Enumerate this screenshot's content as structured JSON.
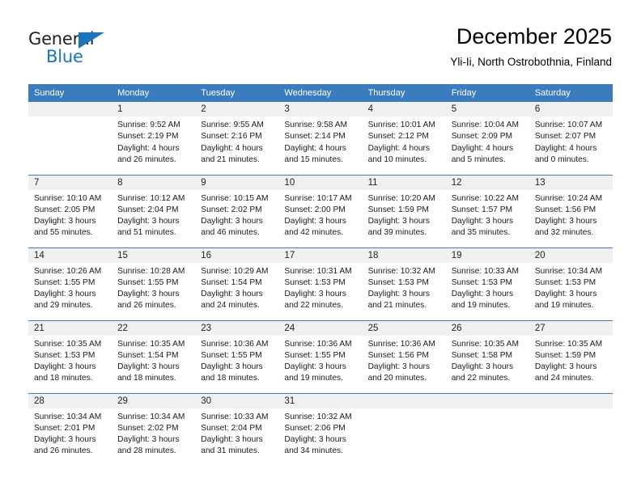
{
  "logo": {
    "word_top": "General",
    "word_bottom": "Blue",
    "triangle_icon": "triangle-icon",
    "color_dark": "#231f20",
    "color_blue": "#1b75bb"
  },
  "header": {
    "title": "December 2025",
    "subtitle": "Yli-Ii, North Ostrobothnia, Finland"
  },
  "theme": {
    "header_bg": "#3b7cbf",
    "header_text": "#ffffff",
    "daynum_bg": "#f0f0f0",
    "grid_line": "#3b7cbf"
  },
  "weekday_headers": [
    "Sunday",
    "Monday",
    "Tuesday",
    "Wednesday",
    "Thursday",
    "Friday",
    "Saturday"
  ],
  "weeks": [
    [
      {
        "day": "",
        "l1": "",
        "l2": "",
        "l3": "",
        "l4": ""
      },
      {
        "day": "1",
        "l1": "Sunrise: 9:52 AM",
        "l2": "Sunset: 2:19 PM",
        "l3": "Daylight: 4 hours",
        "l4": "and 26 minutes."
      },
      {
        "day": "2",
        "l1": "Sunrise: 9:55 AM",
        "l2": "Sunset: 2:16 PM",
        "l3": "Daylight: 4 hours",
        "l4": "and 21 minutes."
      },
      {
        "day": "3",
        "l1": "Sunrise: 9:58 AM",
        "l2": "Sunset: 2:14 PM",
        "l3": "Daylight: 4 hours",
        "l4": "and 15 minutes."
      },
      {
        "day": "4",
        "l1": "Sunrise: 10:01 AM",
        "l2": "Sunset: 2:12 PM",
        "l3": "Daylight: 4 hours",
        "l4": "and 10 minutes."
      },
      {
        "day": "5",
        "l1": "Sunrise: 10:04 AM",
        "l2": "Sunset: 2:09 PM",
        "l3": "Daylight: 4 hours",
        "l4": "and 5 minutes."
      },
      {
        "day": "6",
        "l1": "Sunrise: 10:07 AM",
        "l2": "Sunset: 2:07 PM",
        "l3": "Daylight: 4 hours",
        "l4": "and 0 minutes."
      }
    ],
    [
      {
        "day": "7",
        "l1": "Sunrise: 10:10 AM",
        "l2": "Sunset: 2:05 PM",
        "l3": "Daylight: 3 hours",
        "l4": "and 55 minutes."
      },
      {
        "day": "8",
        "l1": "Sunrise: 10:12 AM",
        "l2": "Sunset: 2:04 PM",
        "l3": "Daylight: 3 hours",
        "l4": "and 51 minutes."
      },
      {
        "day": "9",
        "l1": "Sunrise: 10:15 AM",
        "l2": "Sunset: 2:02 PM",
        "l3": "Daylight: 3 hours",
        "l4": "and 46 minutes."
      },
      {
        "day": "10",
        "l1": "Sunrise: 10:17 AM",
        "l2": "Sunset: 2:00 PM",
        "l3": "Daylight: 3 hours",
        "l4": "and 42 minutes."
      },
      {
        "day": "11",
        "l1": "Sunrise: 10:20 AM",
        "l2": "Sunset: 1:59 PM",
        "l3": "Daylight: 3 hours",
        "l4": "and 39 minutes."
      },
      {
        "day": "12",
        "l1": "Sunrise: 10:22 AM",
        "l2": "Sunset: 1:57 PM",
        "l3": "Daylight: 3 hours",
        "l4": "and 35 minutes."
      },
      {
        "day": "13",
        "l1": "Sunrise: 10:24 AM",
        "l2": "Sunset: 1:56 PM",
        "l3": "Daylight: 3 hours",
        "l4": "and 32 minutes."
      }
    ],
    [
      {
        "day": "14",
        "l1": "Sunrise: 10:26 AM",
        "l2": "Sunset: 1:55 PM",
        "l3": "Daylight: 3 hours",
        "l4": "and 29 minutes."
      },
      {
        "day": "15",
        "l1": "Sunrise: 10:28 AM",
        "l2": "Sunset: 1:55 PM",
        "l3": "Daylight: 3 hours",
        "l4": "and 26 minutes."
      },
      {
        "day": "16",
        "l1": "Sunrise: 10:29 AM",
        "l2": "Sunset: 1:54 PM",
        "l3": "Daylight: 3 hours",
        "l4": "and 24 minutes."
      },
      {
        "day": "17",
        "l1": "Sunrise: 10:31 AM",
        "l2": "Sunset: 1:53 PM",
        "l3": "Daylight: 3 hours",
        "l4": "and 22 minutes."
      },
      {
        "day": "18",
        "l1": "Sunrise: 10:32 AM",
        "l2": "Sunset: 1:53 PM",
        "l3": "Daylight: 3 hours",
        "l4": "and 21 minutes."
      },
      {
        "day": "19",
        "l1": "Sunrise: 10:33 AM",
        "l2": "Sunset: 1:53 PM",
        "l3": "Daylight: 3 hours",
        "l4": "and 19 minutes."
      },
      {
        "day": "20",
        "l1": "Sunrise: 10:34 AM",
        "l2": "Sunset: 1:53 PM",
        "l3": "Daylight: 3 hours",
        "l4": "and 19 minutes."
      }
    ],
    [
      {
        "day": "21",
        "l1": "Sunrise: 10:35 AM",
        "l2": "Sunset: 1:53 PM",
        "l3": "Daylight: 3 hours",
        "l4": "and 18 minutes."
      },
      {
        "day": "22",
        "l1": "Sunrise: 10:35 AM",
        "l2": "Sunset: 1:54 PM",
        "l3": "Daylight: 3 hours",
        "l4": "and 18 minutes."
      },
      {
        "day": "23",
        "l1": "Sunrise: 10:36 AM",
        "l2": "Sunset: 1:55 PM",
        "l3": "Daylight: 3 hours",
        "l4": "and 18 minutes."
      },
      {
        "day": "24",
        "l1": "Sunrise: 10:36 AM",
        "l2": "Sunset: 1:55 PM",
        "l3": "Daylight: 3 hours",
        "l4": "and 19 minutes."
      },
      {
        "day": "25",
        "l1": "Sunrise: 10:36 AM",
        "l2": "Sunset: 1:56 PM",
        "l3": "Daylight: 3 hours",
        "l4": "and 20 minutes."
      },
      {
        "day": "26",
        "l1": "Sunrise: 10:35 AM",
        "l2": "Sunset: 1:58 PM",
        "l3": "Daylight: 3 hours",
        "l4": "and 22 minutes."
      },
      {
        "day": "27",
        "l1": "Sunrise: 10:35 AM",
        "l2": "Sunset: 1:59 PM",
        "l3": "Daylight: 3 hours",
        "l4": "and 24 minutes."
      }
    ],
    [
      {
        "day": "28",
        "l1": "Sunrise: 10:34 AM",
        "l2": "Sunset: 2:01 PM",
        "l3": "Daylight: 3 hours",
        "l4": "and 26 minutes."
      },
      {
        "day": "29",
        "l1": "Sunrise: 10:34 AM",
        "l2": "Sunset: 2:02 PM",
        "l3": "Daylight: 3 hours",
        "l4": "and 28 minutes."
      },
      {
        "day": "30",
        "l1": "Sunrise: 10:33 AM",
        "l2": "Sunset: 2:04 PM",
        "l3": "Daylight: 3 hours",
        "l4": "and 31 minutes."
      },
      {
        "day": "31",
        "l1": "Sunrise: 10:32 AM",
        "l2": "Sunset: 2:06 PM",
        "l3": "Daylight: 3 hours",
        "l4": "and 34 minutes."
      },
      {
        "day": "",
        "l1": "",
        "l2": "",
        "l3": "",
        "l4": ""
      },
      {
        "day": "",
        "l1": "",
        "l2": "",
        "l3": "",
        "l4": ""
      },
      {
        "day": "",
        "l1": "",
        "l2": "",
        "l3": "",
        "l4": ""
      }
    ]
  ]
}
